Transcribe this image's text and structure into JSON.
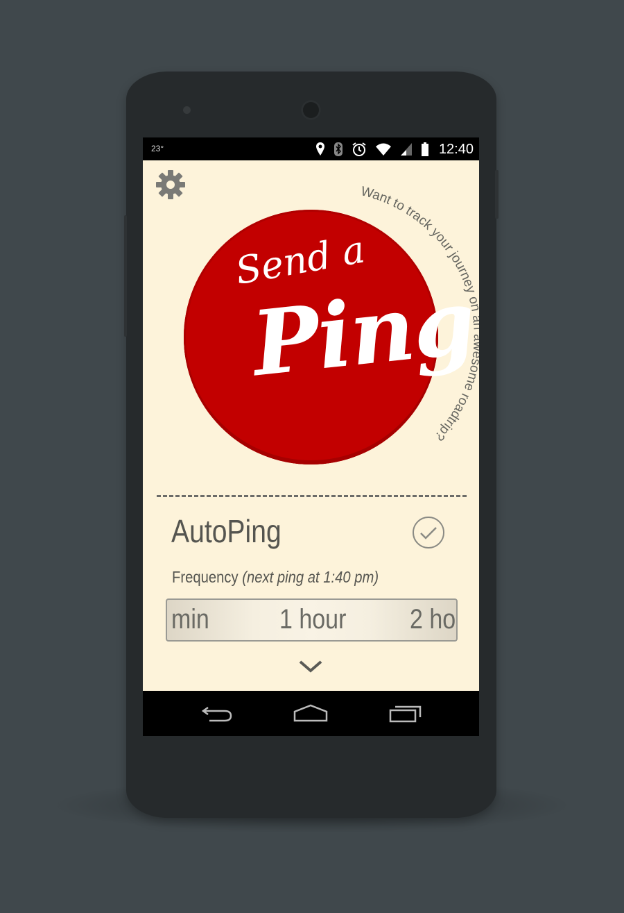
{
  "status_bar": {
    "temperature": "23°",
    "time": "12:40",
    "icons": [
      "location-icon",
      "bluetooth-icon",
      "alarm-icon",
      "wifi-icon",
      "signal-icon",
      "battery-icon"
    ]
  },
  "settings": {
    "icon": "gear-icon"
  },
  "ping_button": {
    "line1": "Send a",
    "line2": "Ping",
    "color": "#c20000"
  },
  "tagline": "Want to track your journey on an awesome roadtrip?",
  "autoping": {
    "label": "AutoPing",
    "enabled": true
  },
  "frequency": {
    "label": "Frequency",
    "note": "(next ping at 1:40 pm)"
  },
  "picker": {
    "options": [
      "min",
      "1 hour",
      "2 ho"
    ],
    "selected": "1 hour"
  },
  "nav": {
    "icons": [
      "back-icon",
      "home-icon",
      "recents-icon"
    ]
  },
  "colors": {
    "background": "#40484c",
    "screen": "#fdf3da",
    "accent": "#c20000"
  }
}
